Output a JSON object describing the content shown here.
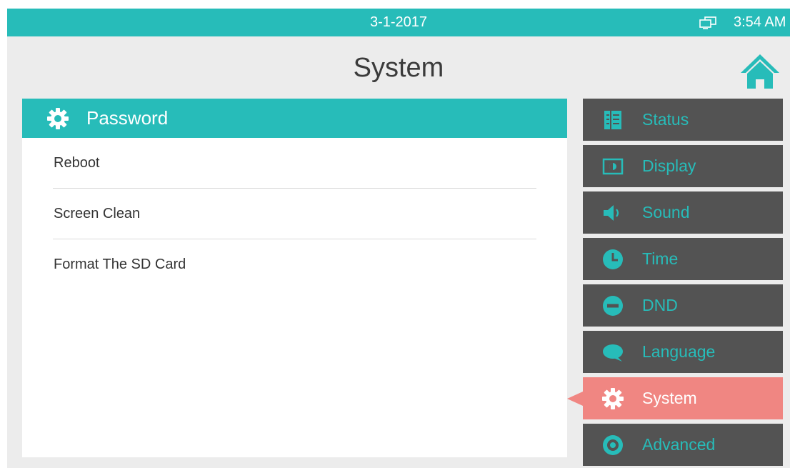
{
  "status_bar": {
    "date": "3-1-2017",
    "time": "3:54 AM",
    "network_icon": "network-icon"
  },
  "page": {
    "title": "System",
    "home_icon": "home-icon"
  },
  "panel": {
    "header": {
      "label": "Password",
      "icon": "gear-icon"
    },
    "items": [
      {
        "label": "Reboot"
      },
      {
        "label": "Screen Clean"
      },
      {
        "label": "Format The SD Card"
      }
    ]
  },
  "menu": {
    "items": [
      {
        "label": "Status",
        "icon": "status-icon"
      },
      {
        "label": "Display",
        "icon": "display-icon"
      },
      {
        "label": "Sound",
        "icon": "speaker-icon"
      },
      {
        "label": "Time",
        "icon": "clock-icon"
      },
      {
        "label": "DND",
        "icon": "dnd-icon"
      },
      {
        "label": "Language",
        "icon": "speech-bubble-icon"
      },
      {
        "label": "System",
        "icon": "gear-icon",
        "selected": true
      },
      {
        "label": "Advanced",
        "icon": "target-icon"
      }
    ]
  },
  "colors": {
    "accent": "#27bcb9",
    "menu_bg": "#535353",
    "selected": "#f08682",
    "background": "#ececec"
  }
}
